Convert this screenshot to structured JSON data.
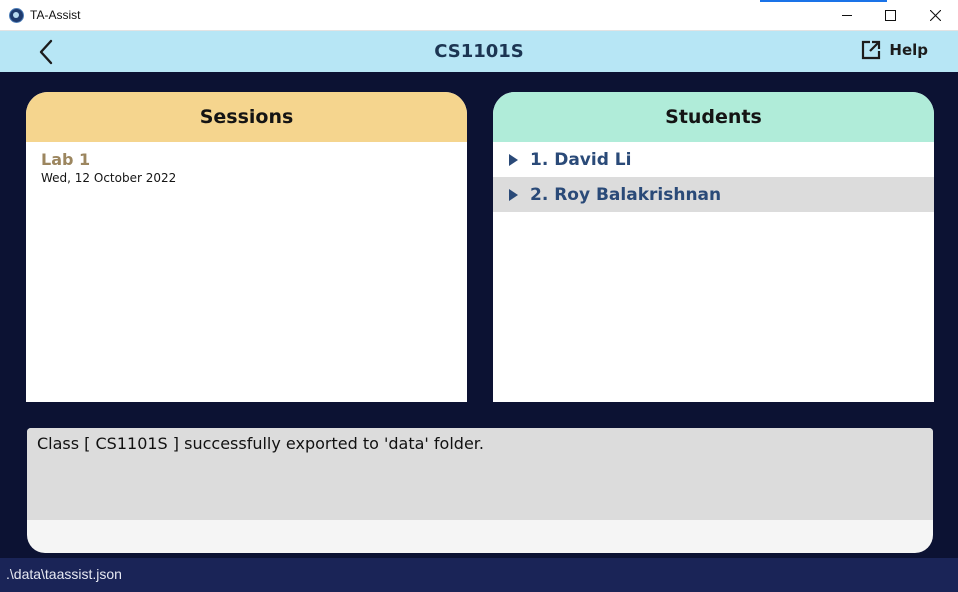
{
  "window": {
    "title": "TA-Assist",
    "controls": [
      "minimize-icon",
      "maximize-icon",
      "close-icon"
    ]
  },
  "topbar": {
    "back_icon": "chevron-left-icon",
    "class_name": "CS1101S",
    "help_icon": "external-link-icon",
    "help_label": "Help"
  },
  "sessions": {
    "header": "Sessions",
    "items": [
      {
        "name": "Lab 1",
        "date": "Wed, 12 October 2022"
      }
    ]
  },
  "students": {
    "header": "Students",
    "items": [
      {
        "label": "1. David Li"
      },
      {
        "label": "2. Roy Balakrishnan"
      }
    ]
  },
  "output": {
    "message": "Class [ CS1101S ] successfully exported to 'data' folder."
  },
  "status": {
    "path": ".\\data\\taassist.json"
  },
  "colors": {
    "background": "#0c1233",
    "topbar": "#b7e6f5",
    "sessions_header": "#f5d58e",
    "students_header": "#b0ecd9",
    "status_bar": "#1a2457",
    "student_text": "#2a4a78",
    "session_name": "#9c865f"
  }
}
